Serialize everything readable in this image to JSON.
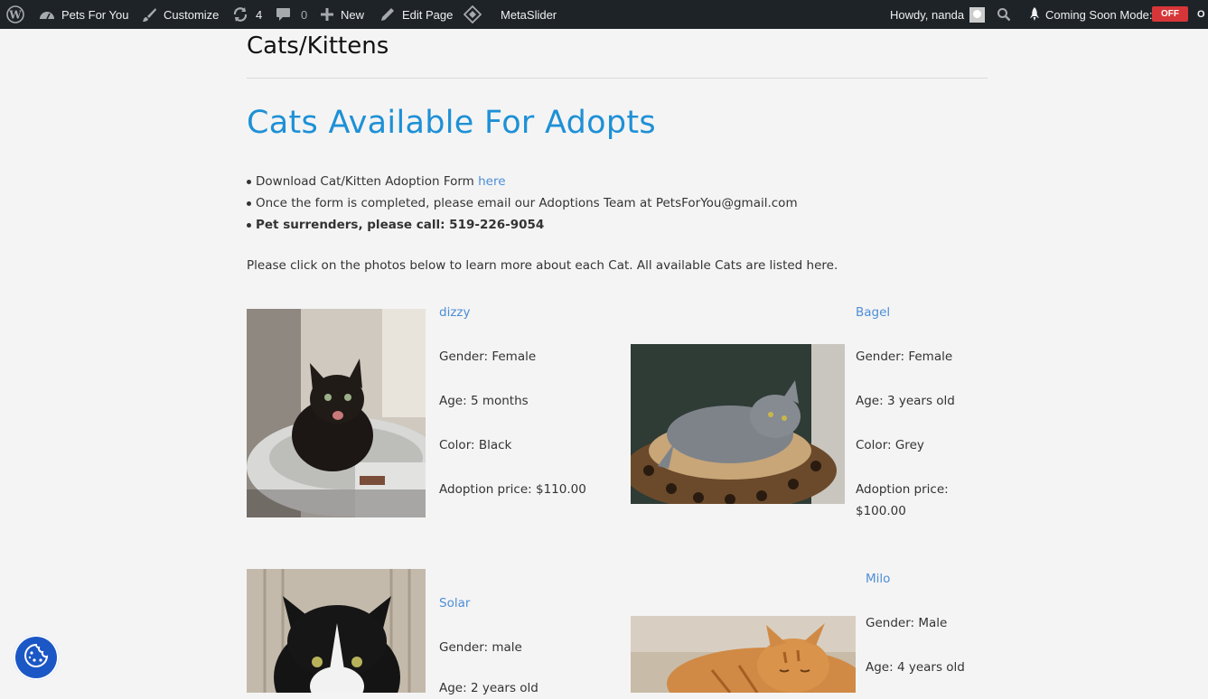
{
  "adminbar": {
    "site_name": "Pets For You",
    "customize": "Customize",
    "updates_count": "4",
    "comments_count": "0",
    "new_label": "New",
    "edit_page": "Edit Page",
    "metaslider": "MetaSlider",
    "howdy": "Howdy, nanda",
    "coming_soon": "Coming Soon Mode:",
    "coming_soon_state": "OFF",
    "overflow_text": "O"
  },
  "page": {
    "title": "Cats/Kittens",
    "heading": "Cats Available For Adopts",
    "bullet1_text": "Download Cat/Kitten Adoption Form ",
    "bullet1_link": "here",
    "bullet2": "Once the form is completed, please email our Adoptions Team at PetsForYou@gmail.com",
    "bullet3": "Pet surrenders, please call:  519-226-9054",
    "intro": "Please click on the photos below to learn more about each Cat. All available Cats are listed here."
  },
  "cats": [
    {
      "name": "dizzy",
      "gender": "Gender: Female",
      "age": "Age: 5 months",
      "color": "Color: Black",
      "price": "Adoption price: $110.00"
    },
    {
      "name": "Bagel",
      "gender": "Gender: Female",
      "age": "Age: 3 years old",
      "color": "Color: Grey",
      "price_l1": "Adoption price:",
      "price_l2": "$100.00"
    },
    {
      "name": "Solar",
      "gender": "Gender: male",
      "age": "Age: 2 years old"
    },
    {
      "name": "Milo",
      "gender": "Gender: Male",
      "age": "Age: 4 years old"
    }
  ],
  "colors": {
    "adminbar_bg": "#1d2327",
    "heading_blue": "#1e90d6",
    "link_blue": "#4d8ed8",
    "off_red": "#d63638",
    "cookie_blue": "#1c57c6"
  }
}
